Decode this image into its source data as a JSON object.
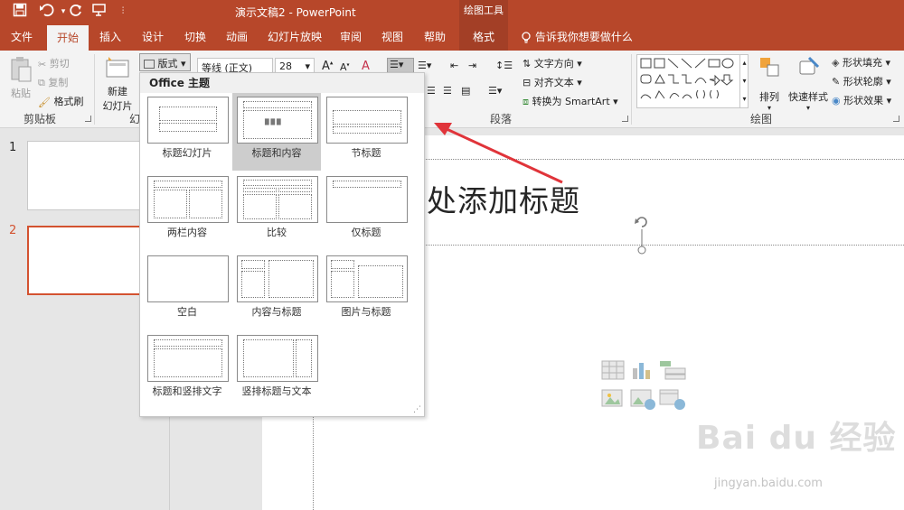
{
  "titlebar": {
    "doc_title": "演示文稿2  -  PowerPoint",
    "context_tools": "绘图工具",
    "bg": "#b7472a"
  },
  "tabs": [
    "文件",
    "开始",
    "插入",
    "设计",
    "切换",
    "动画",
    "幻灯片放映",
    "审阅",
    "视图",
    "帮助",
    "格式"
  ],
  "active_tab": "开始",
  "tellme": "告诉我你想要做什么",
  "clipboard": {
    "paste": "粘贴",
    "cut": "剪切",
    "copy": "复制",
    "format_painter": "格式刷",
    "group_label": "剪贴板"
  },
  "slides_group": {
    "new_slide_1": "新建",
    "new_slide_2": "幻灯片",
    "layout": "版式",
    "group_label_partial": "幻"
  },
  "font": {
    "name": "等线 (正文)",
    "size": "28"
  },
  "paragraph": {
    "text_direction": "文字方向",
    "align_text": "对齐文本",
    "smartart": "转换为 SmartArt",
    "group_label": "段落"
  },
  "drawing": {
    "arrange": "排列",
    "quick_styles": "快速样式",
    "shape_fill": "形状填充",
    "shape_outline": "形状轮廓",
    "shape_effects": "形状效果",
    "group_label": "绘图"
  },
  "layout_menu": {
    "header": "Office 主题",
    "items": [
      {
        "label": "标题幻灯片"
      },
      {
        "label": "标题和内容"
      },
      {
        "label": "节标题"
      },
      {
        "label": "两栏内容"
      },
      {
        "label": "比较"
      },
      {
        "label": "仅标题"
      },
      {
        "label": "空白"
      },
      {
        "label": "内容与标题"
      },
      {
        "label": "图片与标题"
      },
      {
        "label": "标题和竖排文字"
      },
      {
        "label": "竖排标题与文本"
      }
    ]
  },
  "thumbnails": [
    "1",
    "2"
  ],
  "slide": {
    "title_partial": "处添加标题"
  },
  "colors": {
    "accent": "#b7472a",
    "selection": "#d35230",
    "arrow": "#e0343a"
  },
  "watermark": {
    "brand": "Bai du 经验",
    "url": "jingyan.baidu.com"
  }
}
